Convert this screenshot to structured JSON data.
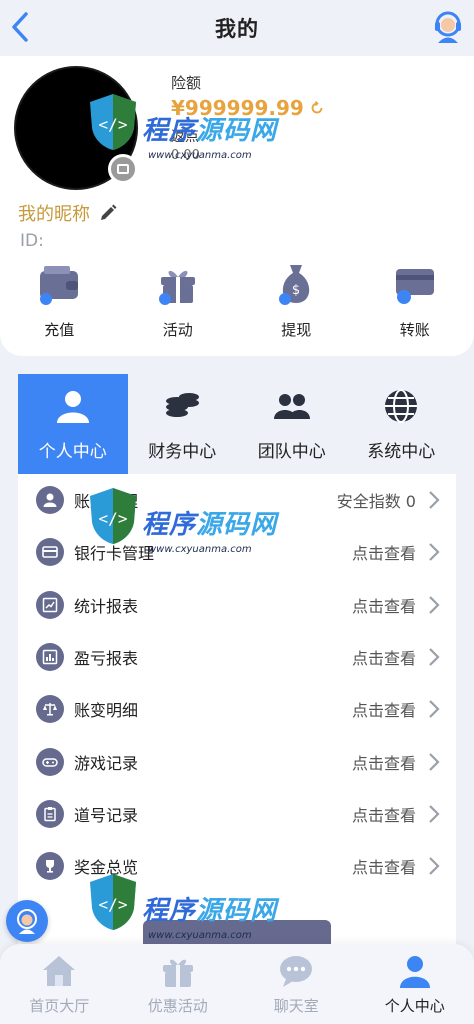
{
  "header": {
    "title": "我的",
    "back_icon": "chevron-left-icon",
    "service_icon": "customer-service-icon"
  },
  "profile": {
    "balance_label": "险额",
    "balance_value": "¥999999.99",
    "rebate_label": "返点",
    "rebate_value": "0.00",
    "nickname": "我的昵称",
    "id_label": "ID:"
  },
  "quick_actions": [
    {
      "label": "充值",
      "icon": "wallet-icon"
    },
    {
      "label": "活动",
      "icon": "gift-icon"
    },
    {
      "label": "提现",
      "icon": "money-bag-icon"
    },
    {
      "label": "转账",
      "icon": "card-transfer-icon"
    }
  ],
  "tabs": [
    {
      "label": "个人中心",
      "icon": "person-icon",
      "active": true
    },
    {
      "label": "财务中心",
      "icon": "coins-icon",
      "active": false
    },
    {
      "label": "团队中心",
      "icon": "team-icon",
      "active": false
    },
    {
      "label": "系统中心",
      "icon": "globe-icon",
      "active": false
    }
  ],
  "menu": [
    {
      "label": "账户管理",
      "value": "安全指数 0",
      "icon": "user-icon"
    },
    {
      "label": "银行卡管理",
      "value": "点击查看",
      "icon": "card-icon"
    },
    {
      "label": "统计报表",
      "value": "点击查看",
      "icon": "chart-line-icon"
    },
    {
      "label": "盈亏报表",
      "value": "点击查看",
      "icon": "chart-bar-icon"
    },
    {
      "label": "账变明细",
      "value": "点击查看",
      "icon": "scale-icon"
    },
    {
      "label": "游戏记录",
      "value": "点击查看",
      "icon": "gamepad-icon"
    },
    {
      "label": "道号记录",
      "value": "点击查看",
      "icon": "clipboard-icon"
    },
    {
      "label": "奖金总览",
      "value": "点击查看",
      "icon": "trophy-icon"
    }
  ],
  "bottom_nav": [
    {
      "label": "首页大厅",
      "icon": "home-icon",
      "active": false
    },
    {
      "label": "优惠活动",
      "icon": "gift-icon",
      "active": false
    },
    {
      "label": "聊天室",
      "icon": "chat-icon",
      "active": false
    },
    {
      "label": "个人中心",
      "icon": "person-icon",
      "active": true
    }
  ],
  "watermark": {
    "title_a": "程序",
    "title_b": "源码网",
    "url": "www.cxyuanma.com"
  },
  "colors": {
    "accent": "#3d85f4",
    "gold": "#e7a33e",
    "menu_icon_bg": "#676a8f"
  }
}
